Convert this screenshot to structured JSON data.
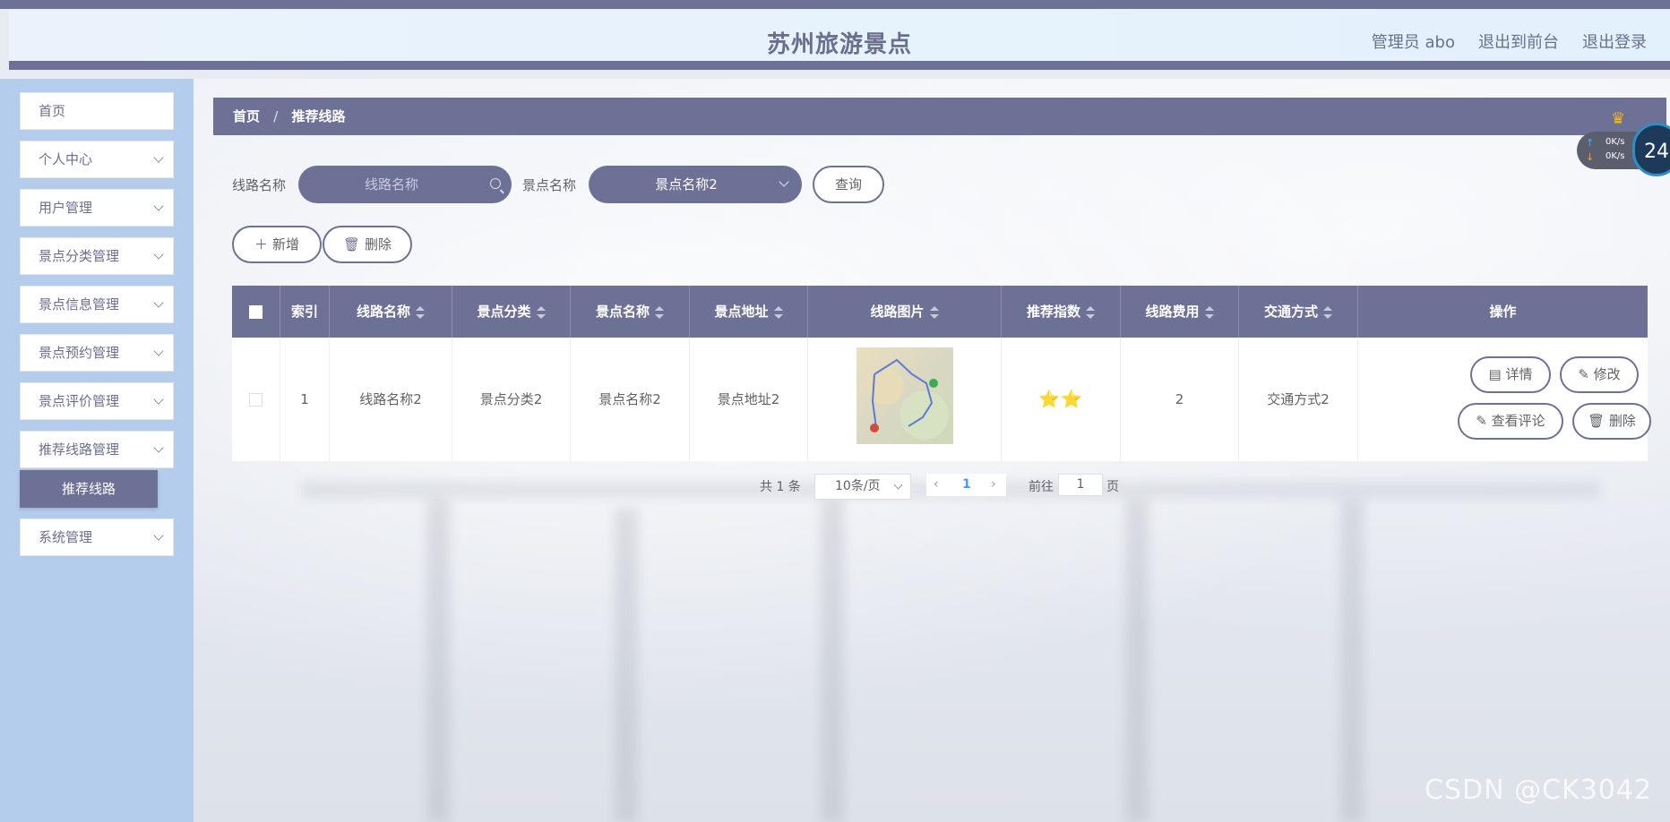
{
  "header": {
    "title": "苏州旅游景点",
    "links": [
      "管理员 abo",
      "退出到前台",
      "退出登录"
    ]
  },
  "sidebar": {
    "items": [
      {
        "label": "首页"
      },
      {
        "label": "个人中心"
      },
      {
        "label": "用户管理"
      },
      {
        "label": "景点分类管理"
      },
      {
        "label": "景点信息管理"
      },
      {
        "label": "景点预约管理"
      },
      {
        "label": "景点评价管理"
      },
      {
        "label": "推荐线路管理"
      },
      {
        "label": "系统管理"
      }
    ],
    "active_sub": "推荐线路"
  },
  "breadcrumb": {
    "home": "首页",
    "sep": "/",
    "current": "推荐线路"
  },
  "search": {
    "route_label": "线路名称",
    "route_placeholder": "线路名称",
    "spot_label": "景点名称",
    "spot_value": "景点名称2",
    "query_button": "查询"
  },
  "actions": {
    "add": "新增",
    "delete": "删除"
  },
  "table": {
    "headers": [
      "索引",
      "线路名称",
      "景点分类",
      "景点名称",
      "景点地址",
      "线路图片",
      "推荐指数",
      "线路费用",
      "交通方式",
      "操作"
    ],
    "rows": [
      {
        "index": "1",
        "route_name": "线路名称2",
        "category": "景点分类2",
        "spot_name": "景点名称2",
        "address": "景点地址2",
        "rating": "⭐⭐",
        "fee": "2",
        "transport": "交通方式2"
      }
    ],
    "row_actions": {
      "detail": "详情",
      "edit": "修改",
      "comments": "查看评论",
      "delete": "删除"
    }
  },
  "pagination": {
    "total": "共 1 条",
    "page_size": "10条/页",
    "current_page": "1",
    "goto_label": "前往",
    "goto_value": "1",
    "page_suffix": "页"
  },
  "widgets": {
    "upload_speed": "0K/s",
    "download_speed": "0K/s",
    "dial_value": "24"
  },
  "watermark": "CSDN @CK3042"
}
